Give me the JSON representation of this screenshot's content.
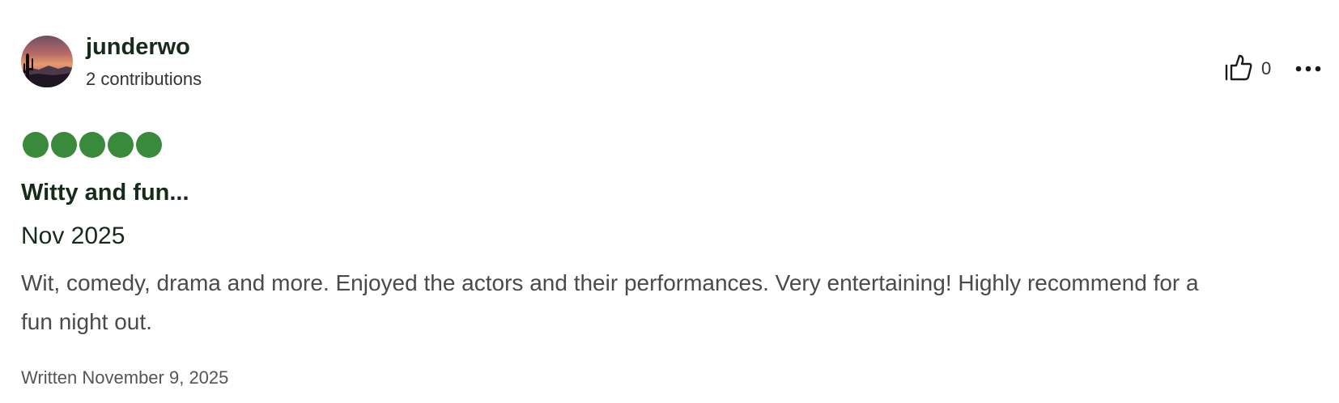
{
  "review": {
    "user": {
      "name": "junderwo",
      "contributions": "2 contributions",
      "avatar_icon": "sunset-saguaro-avatar"
    },
    "helpful_count": "0",
    "rating": {
      "value": 5,
      "max": 5,
      "color": "#3a8a3c"
    },
    "title": "Witty and fun...",
    "visit_date": "Nov 2025",
    "body": "Wit, comedy, drama and more. Enjoyed the actors and their performances. Very entertaining! Highly recommend for a fun night out.",
    "written": "Written November 9, 2025"
  },
  "icons": {
    "helpful": "thumbs-up-icon",
    "more": "more-options-icon"
  },
  "colors": {
    "text_primary": "#172b1b",
    "text_secondary": "#4a4a4a"
  }
}
